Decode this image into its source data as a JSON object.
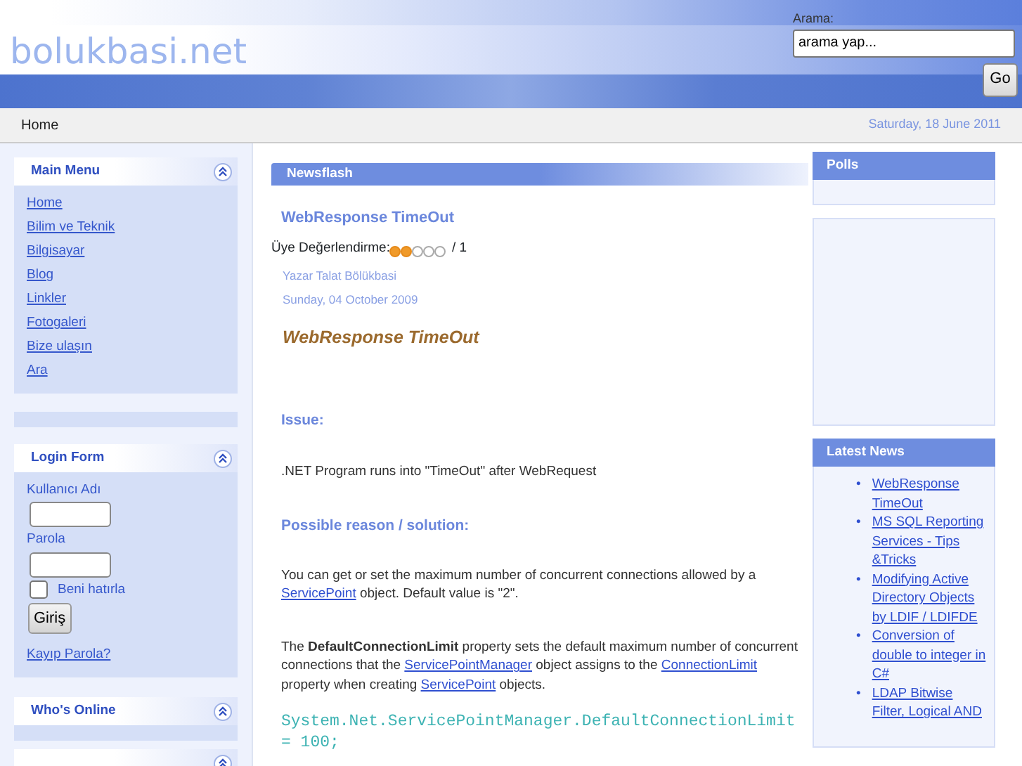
{
  "site": {
    "title": "bolukbasi.net"
  },
  "search": {
    "label": "Arama:",
    "value": "arama yap...",
    "button": "Go"
  },
  "breadcrumb": "Home",
  "date": "Saturday, 18 June 2011",
  "main_menu": {
    "title": "Main Menu",
    "items": [
      "Home",
      "Bilim ve Teknik",
      "Bilgisayar",
      "Blog",
      "Linkler",
      "Fotogaleri",
      "Bize ulaşın",
      "Ara"
    ]
  },
  "login_form": {
    "title": "Login Form",
    "username_label": "Kullanıcı Adı",
    "password_label": "Parola",
    "remember_label": "Beni hatırla",
    "remember_checked": false,
    "submit": "Giriş",
    "lost_password": "Kayıp Parola?"
  },
  "whos_online": {
    "title": "Who's Online"
  },
  "newsflash": {
    "title": "Newsflash",
    "article_title": "WebResponse TimeOut",
    "rating_label": "Üye Değerlendirme:",
    "stars": 2,
    "votes": "/ 1",
    "author": "Yazar Talat Bölükbasi",
    "date": "Sunday, 04 October 2009",
    "body": [
      {
        "kind": "heading",
        "text": "WebResponse TimeOut"
      },
      {
        "kind": "subheading",
        "text": "Issue:"
      },
      {
        "kind": "para",
        "text": ".NET Program runs into \"TimeOut\" after WebRequest"
      },
      {
        "kind": "subheading",
        "text": "Possible reason / solution:"
      },
      {
        "kind": "para",
        "parts": [
          {
            "text": "You can get or set the maximum number of concurrent connections allowed by a "
          },
          {
            "link": "ServicePoint"
          },
          {
            "text": " object. Default value is \"2\"."
          }
        ]
      },
      {
        "kind": "para",
        "parts": [
          {
            "text": "The **DefaultConnectionLimit** property sets the default maximum number of concurrent connections that the "
          },
          {
            "link": "ServicePointManager"
          },
          {
            "text": " object assigns to the "
          },
          {
            "link": "ConnectionLimit"
          },
          {
            "text": " property when creating "
          },
          {
            "link": "ServicePoint"
          },
          {
            "text": " objects."
          }
        ]
      },
      {
        "kind": "code",
        "text": "System.Net.ServicePointManager.DefaultConnectionLimit = 100;"
      }
    ]
  },
  "polls": {
    "title": "Polls"
  },
  "latest_news": {
    "title": "Latest News",
    "marker": "•",
    "items": [
      "WebResponse TimeOut",
      "MS SQL Reporting Services - Tips &Tricks",
      "Modifying Active Directory Objects by LDIF / LDIFDE",
      "Conversion of double to integer in C#",
      "LDAP Bitwise Filter, Logical AND"
    ]
  }
}
